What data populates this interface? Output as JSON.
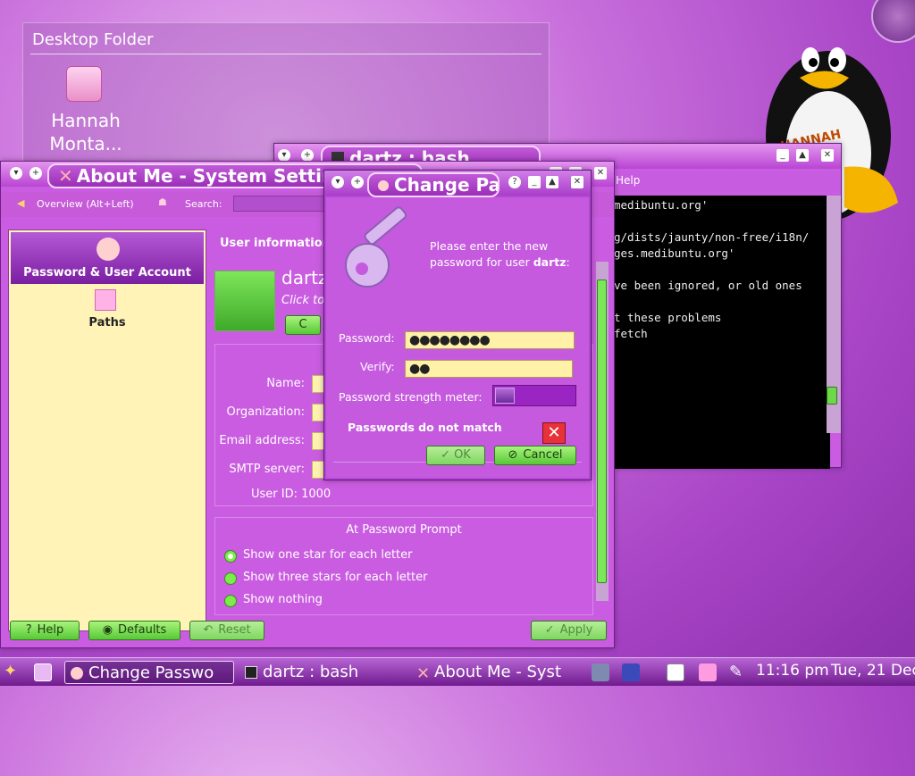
{
  "desktop": {
    "folder_title": "Desktop Folder",
    "icon_label_line1": "Hannah",
    "icon_label_line2": "Monta..."
  },
  "terminal": {
    "title": "dartz : bash",
    "menu_help": "Help",
    "lines": [
      "medibuntu.org'",
      "",
      "g/dists/jaunty/non-free/i18n/",
      "ges.medibuntu.org'",
      "",
      "ve been ignored, or old ones",
      "",
      "t these problems",
      "fetch"
    ]
  },
  "about": {
    "title": "About Me - System Settings",
    "overview_label": "Overview (Alt+Left)",
    "search_label": "Search:",
    "search_value": "",
    "sidebar_items": [
      {
        "label": "Password & User Account"
      },
      {
        "label": "Paths"
      }
    ],
    "section_heading": "User information",
    "username": "dartz",
    "click_hint": "Click to",
    "change_button": "C",
    "fields": {
      "name_label": "Name:",
      "org_label": "Organization:",
      "email_label": "Email address:",
      "smtp_label": "SMTP server:",
      "userid_text": "User ID: 1000"
    },
    "prompt_group_title": "At Password Prompt",
    "radios": [
      {
        "label": "Show one star for each letter",
        "checked": true
      },
      {
        "label": "Show three stars for each letter",
        "checked": false
      },
      {
        "label": "Show nothing",
        "checked": false
      }
    ],
    "buttons": {
      "help": "Help",
      "defaults": "Defaults",
      "reset": "Reset",
      "apply": "Apply"
    }
  },
  "password_dialog": {
    "title": "Change Pa",
    "instructions_line1": "Please enter the new",
    "instructions_line2_prefix": "password for user ",
    "instructions_user": "dartz",
    "instructions_suffix": ":",
    "password_label": "Password:",
    "password_value": "●●●●●●●●",
    "verify_label": "Verify:",
    "verify_value": "●●",
    "strength_label": "Password strength meter:",
    "strength_fraction": 0.25,
    "mismatch_text": "Passwords do not match",
    "ok_label": "OK",
    "cancel_label": "Cancel"
  },
  "taskbar": {
    "tasks": [
      {
        "label": "Change Passwo",
        "active": true
      },
      {
        "label": "dartz : bash",
        "active": false
      },
      {
        "label": "About Me - Syst",
        "active": false
      }
    ],
    "clock_time": "11:16 pm",
    "clock_date": "Tue, 21 Dec"
  },
  "colors": {
    "accent": "#b845d2",
    "button_green": "#58c936",
    "field_yellow": "#fff3b0",
    "sidebar_bg": "#fff3b8"
  }
}
